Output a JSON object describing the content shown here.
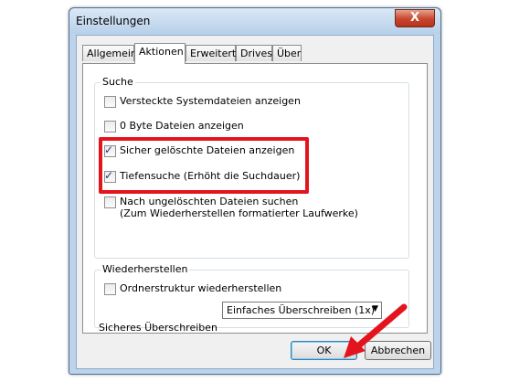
{
  "window": {
    "title": "Einstellungen",
    "close_label": "X"
  },
  "tabs": [
    {
      "label": "Allgemein",
      "active": false
    },
    {
      "label": "Aktionen",
      "active": true
    },
    {
      "label": "Erweitert",
      "active": false
    },
    {
      "label": "Drives",
      "active": false
    },
    {
      "label": "Über",
      "active": false
    }
  ],
  "search_group": {
    "label": "Suche",
    "options": [
      {
        "label": "Versteckte Systemdateien anzeigen",
        "checked": false
      },
      {
        "label": "0 Byte Dateien anzeigen",
        "checked": false
      },
      {
        "label": "Sicher gelöschte Dateien anzeigen",
        "checked": true
      },
      {
        "label": "Tiefensuche (Erhöht die Suchdauer)",
        "checked": true
      },
      {
        "label": "Nach ungelöschten Dateien suchen",
        "label_line2": "(Zum Wiederherstellen formatierter Laufwerke)",
        "checked": false
      }
    ]
  },
  "restore_group": {
    "label": "Wiederherstellen",
    "option": {
      "label": "Ordnerstruktur wiederherstellen",
      "checked": false
    },
    "overwrite_label": "Sicheres Überschreiben",
    "overwrite_value": "Einfaches Überschreiben (1x)"
  },
  "buttons": {
    "ok": "OK",
    "cancel": "Abbrechen"
  },
  "annotation_color": "#e4141e"
}
